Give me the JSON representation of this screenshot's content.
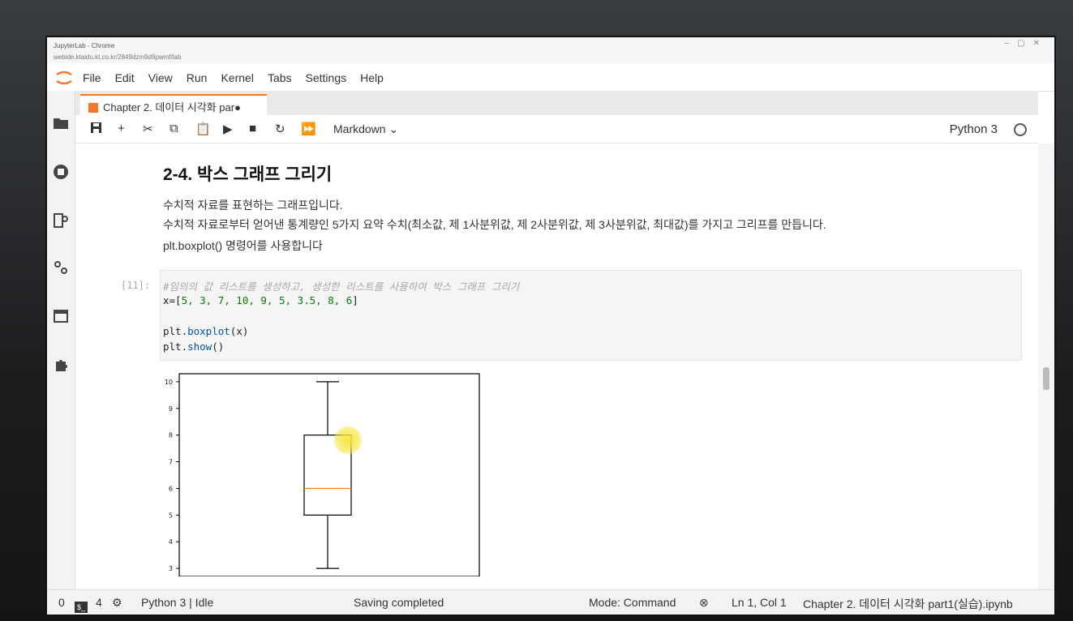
{
  "browser": {
    "title": "JupyterLab - Chrome",
    "url": "webide.ktaidu.kt.co.kr/2849dzm9d9pwmf/lab"
  },
  "menu": [
    "File",
    "Edit",
    "View",
    "Run",
    "Kernel",
    "Tabs",
    "Settings",
    "Help"
  ],
  "tab": {
    "label": "Chapter 2. 데이터 시각화 par●"
  },
  "toolbar": {
    "cell_type": "Markdown ⌄",
    "kernel": "Python 3"
  },
  "markdown": {
    "heading": "2-4. 박스 그래프 그리기",
    "line1": "수치적 자료를 표현하는 그래프입니다.",
    "line2": "수치적 자료로부터 얻어낸 통계량인 5가지 요약 수치(최소값, 제 1사분위값, 제 2사분위값, 제 3사분위값, 최대값)를 가지고 그리프를 만듭니다.",
    "line3": "plt.boxplot() 명령어를 사용합니다"
  },
  "code_cell": {
    "prompt": "[11]:",
    "comment": "#임의의 값 리스트를 생성하고, 생성한 리스트를 사용하여 박스 그래프 그리기",
    "line_x_prefix": "x=[",
    "line_x_values": "5, 3, 7, 10, 9, 5, 3.5, 8, 6",
    "line_x_suffix": "]",
    "line_boxplot_a": "plt.",
    "line_boxplot_fn": "boxplot",
    "line_boxplot_b": "(x)",
    "line_show_a": "plt.",
    "line_show_fn": "show",
    "line_show_b": "()"
  },
  "chart_data": {
    "type": "boxplot",
    "data": [
      5,
      3,
      7,
      10,
      9,
      5,
      3.5,
      8,
      6
    ],
    "min": 3,
    "q1": 5,
    "median": 6,
    "q3": 8,
    "max": 10,
    "ylim": [
      2.7,
      10.3
    ],
    "yticks": [
      3,
      4,
      5,
      6,
      7,
      8,
      9,
      10
    ],
    "box_color": "#000000",
    "median_color": "#ff7f0e"
  },
  "status": {
    "zero": "0",
    "terminals": "4",
    "kernel_state": "Python 3 | Idle",
    "save_state": "Saving completed",
    "mode": "Mode: Command",
    "position": "Ln 1, Col 1",
    "filename": "Chapter 2. 데이터 시각화 part1(실습).ipynb"
  }
}
